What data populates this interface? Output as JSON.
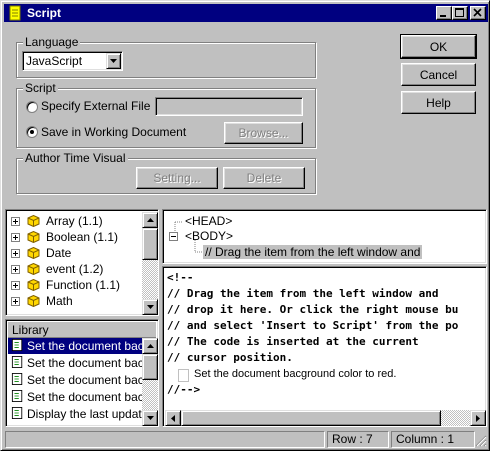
{
  "window": {
    "title": "Script"
  },
  "buttons": {
    "ok": "OK",
    "cancel": "Cancel",
    "help": "Help"
  },
  "language": {
    "label": "Language",
    "value": "JavaScript"
  },
  "script": {
    "label": "Script",
    "external_label": "Specify External File",
    "external_value": "",
    "browse": "Browse...",
    "save_label": "Save in Working Document",
    "selected": "Save in Working Document"
  },
  "author_visual": {
    "label": "Author Time Visual",
    "setting": "Setting...",
    "delete": "Delete"
  },
  "object_tree": {
    "items": [
      "Array (1.1)",
      "Boolean (1.1)",
      "Date",
      "event (1.2)",
      "Function (1.1)",
      "Math"
    ]
  },
  "library": {
    "title": "Library",
    "items": [
      "Set the document bacgro",
      "Set the document bacgro",
      "Set the document bacgro",
      "Set the document bacgro",
      "Display the last update ti"
    ]
  },
  "doc_tree": {
    "head": "<HEAD>",
    "body": "<BODY>",
    "child": "// Drag the item from the left window and"
  },
  "code_editor": {
    "lines": [
      "<!--",
      "// Drag the item from the left window and",
      "// drop it here. Or click the right mouse bu",
      "// and select 'Insert to Script' from the po",
      "// The code is inserted at the current",
      "// cursor position."
    ],
    "snippet": "Set the document bacground color to red.",
    "end_line": "//-->"
  },
  "status_bar": {
    "row": "Row : 7",
    "column": "Column : 1"
  },
  "colors": {
    "title_bg": "#000080",
    "face": "#c0c0c0",
    "highlight": "#000080",
    "selection_gray": "#c0c0c0"
  }
}
